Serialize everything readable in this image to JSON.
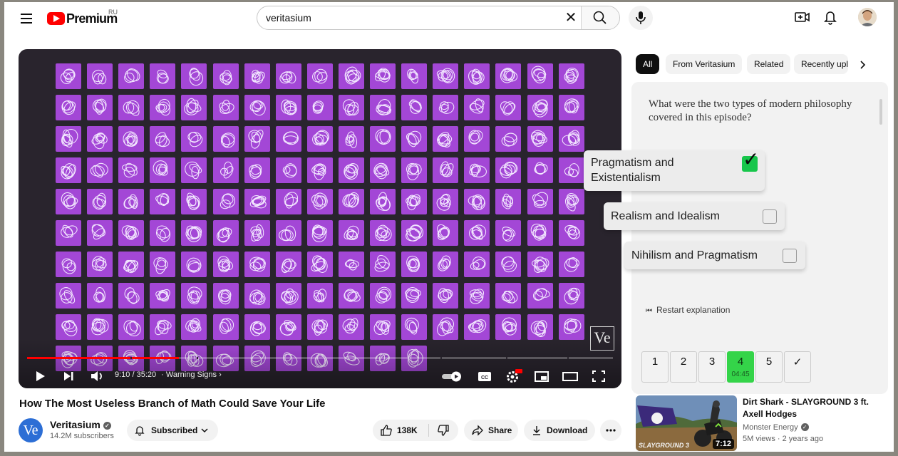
{
  "masthead": {
    "logo_text": "Premium",
    "country_code": "RU",
    "search_value": "veritasium"
  },
  "player": {
    "time_current": "9:10",
    "time_total": "35:20",
    "time_display": "9:10 / 35:20",
    "chapter": "Warning Signs",
    "watermark": "Ve",
    "watermark_sub": "42.0",
    "progress_fraction": 0.259,
    "tile_rows": 10,
    "tile_cols": 17,
    "last_row_tiles": 12
  },
  "video": {
    "title": "How The Most Useless Branch of Math Could Save Your Life",
    "channel": "Veritasium",
    "channel_avatar_text": "Ve",
    "subscribers": "14.2M subscribers",
    "subscribe_label": "Subscribed",
    "likes": "138K",
    "share_label": "Share",
    "download_label": "Download"
  },
  "sidebar": {
    "chips": [
      "All",
      "From Veritasium",
      "Related",
      "Recently uploaded"
    ],
    "quiz": {
      "question": "What were the two types of modern philosophy covered in this episode?",
      "answers": [
        {
          "text": "Pragmatism and Existentialism",
          "checked": true
        },
        {
          "text": "Realism and Idealism",
          "checked": false
        },
        {
          "text": "Nihilism and Pragmatism",
          "checked": false
        }
      ],
      "restart_label": "Restart explanation",
      "steps": [
        "1",
        "2",
        "3",
        "4",
        "5",
        "✓"
      ],
      "current_step_time": "04:45"
    },
    "recommendation": {
      "title": "Dirt Shark - SLAYGROUND 3 ft. Axell Hodges",
      "channel": "Monster Energy",
      "meta": "5M views · 2 years ago",
      "duration": "7:12",
      "thumb_text": "SLAYGROUND 3"
    }
  },
  "colors": {
    "accent_red": "#ff0000",
    "tile_purple": "#a347d6",
    "player_bg": "#29242d",
    "quiz_green": "#34d449"
  }
}
